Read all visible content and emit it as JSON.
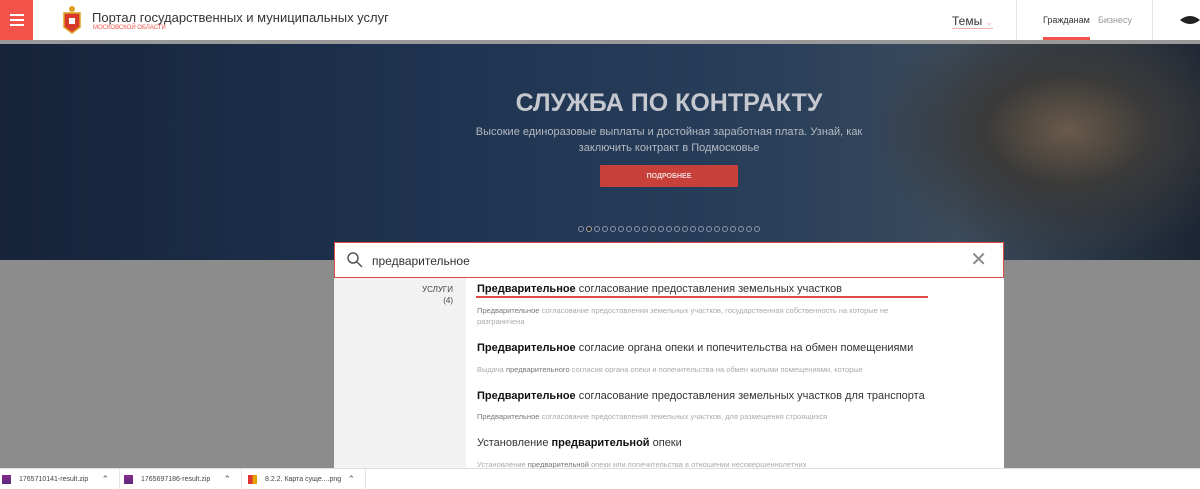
{
  "header": {
    "title": "Портал государственных и муниципальных услуг",
    "subtitle": "МОСКОВСКОЙ ОБЛАСТИ",
    "themes": "Темы",
    "nav": [
      "Гражданам",
      "Бизнесу"
    ]
  },
  "banner": {
    "title": "СЛУЖБА ПО КОНТРАКТУ",
    "subtitle": "Высокие единоразовые выплаты и достойная заработная плата. Узнай, как заключить контракт в Подмосковье",
    "button": "ПОДРОБНЕЕ",
    "dots_count": 23,
    "active_dot": 2
  },
  "search": {
    "value": "предварительное"
  },
  "results": {
    "category": "УСЛУГИ",
    "count": "(4)",
    "items": [
      {
        "pre": "",
        "hl": "Предварительное",
        "post": " согласование предоставления земельных участков",
        "dpre": "",
        "dhl": "Предварительное",
        "dpost": " согласование предоставления земельных участков, государственная собственность на которые не разграничена"
      },
      {
        "pre": "",
        "hl": "Предварительное",
        "post": " согласие органа опеки и попечительства на обмен помещениями",
        "dpre": "Выдача ",
        "dhl": "предварительного",
        "dpost": " согласия органа опеки и попечительства на обмен жилыми помещениями, которые"
      },
      {
        "pre": "",
        "hl": "Предварительное",
        "post": " согласование предоставления земельных участков для транспорта",
        "dpre": "",
        "dhl": "Предварительное",
        "dpost": " согласование предоставления земельных участков, для размещения строящихся"
      },
      {
        "pre": "Установление ",
        "hl": "предварительной",
        "post": " опеки",
        "dpre": "Установление ",
        "dhl": "предварительной",
        "dpost": " опеки или попечительства в отношении несовершеннолетних"
      }
    ]
  },
  "downloads": [
    "1765710141-result.zip",
    "1765697186-result.zip",
    "8.2.2. Карта суще....png"
  ]
}
